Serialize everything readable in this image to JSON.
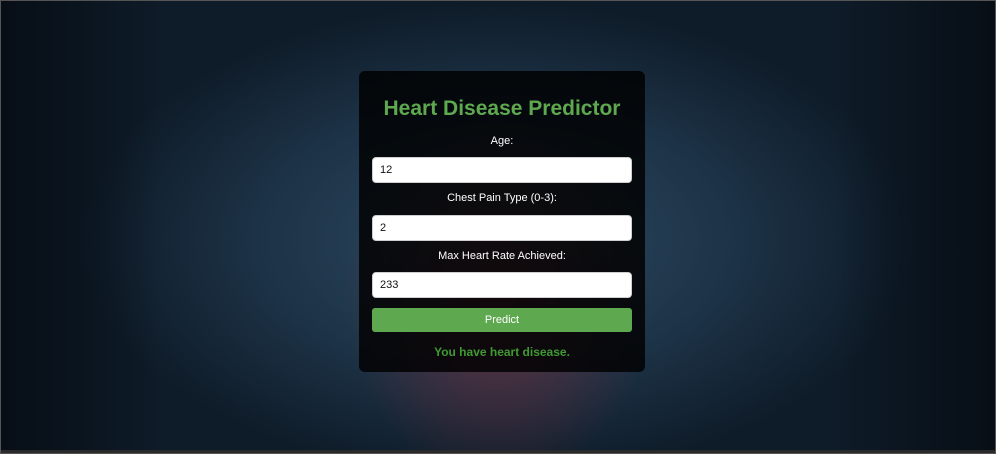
{
  "form": {
    "title": "Heart Disease Predictor",
    "fields": [
      {
        "label": "Age:",
        "value": "12"
      },
      {
        "label": "Chest Pain Type (0-3):",
        "value": "2"
      },
      {
        "label": "Max Heart Rate Achieved:",
        "value": "233"
      }
    ],
    "submit_label": "Predict",
    "result": "You have heart disease."
  },
  "colors": {
    "accent": "#5ea94f",
    "result_text": "#3f9a31",
    "card_bg": "#000000"
  }
}
